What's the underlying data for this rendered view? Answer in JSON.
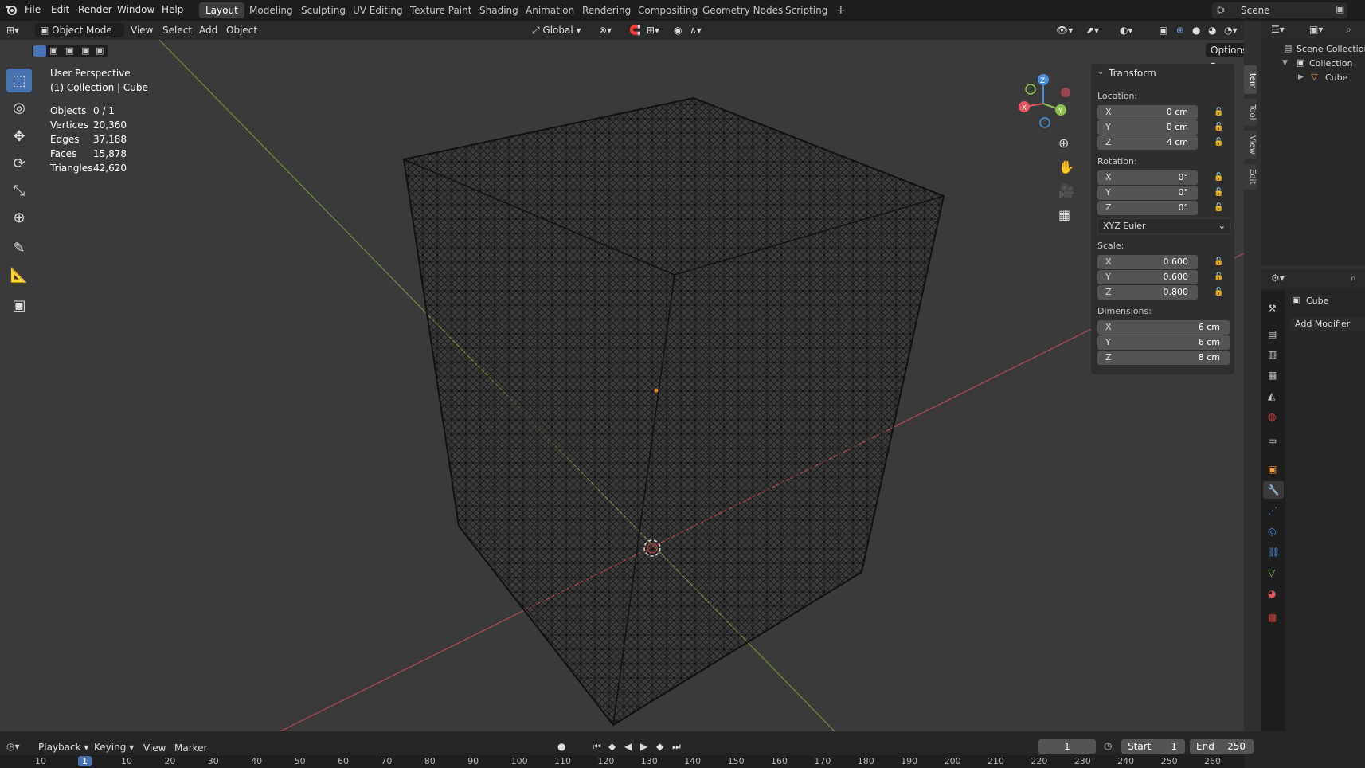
{
  "topbar": {
    "menus": [
      "File",
      "Edit",
      "Render",
      "Window",
      "Help"
    ],
    "workspaces": [
      "Layout",
      "Modeling",
      "Sculpting",
      "UV Editing",
      "Texture Paint",
      "Shading",
      "Animation",
      "Rendering",
      "Compositing",
      "Geometry Nodes",
      "Scripting"
    ],
    "add_tab": "+",
    "scene_label": "Scene"
  },
  "header": {
    "mode": "Object Mode",
    "menus": [
      "View",
      "Select",
      "Add",
      "Object"
    ],
    "orientation": "Global",
    "options_label": "Options"
  },
  "viewport": {
    "view_name": "User Perspective",
    "collection_line": "(1) Collection | Cube",
    "stats": [
      {
        "label": "Objects",
        "value": "0 / 1"
      },
      {
        "label": "Vertices",
        "value": "20,360"
      },
      {
        "label": "Edges",
        "value": "37,188"
      },
      {
        "label": "Faces",
        "value": "15,878"
      },
      {
        "label": "Triangles",
        "value": "42,620"
      }
    ],
    "gizmo": {
      "z": "Z",
      "y": "Y",
      "x": "X"
    }
  },
  "transform": {
    "title": "Transform",
    "location_label": "Location:",
    "location": [
      {
        "axis": "X",
        "value": "0 cm"
      },
      {
        "axis": "Y",
        "value": "0 cm"
      },
      {
        "axis": "Z",
        "value": "4 cm"
      }
    ],
    "rotation_label": "Rotation:",
    "rotation": [
      {
        "axis": "X",
        "value": "0°"
      },
      {
        "axis": "Y",
        "value": "0°"
      },
      {
        "axis": "Z",
        "value": "0°"
      }
    ],
    "rotation_mode": "XYZ Euler",
    "scale_label": "Scale:",
    "scale": [
      {
        "axis": "X",
        "value": "0.600"
      },
      {
        "axis": "Y",
        "value": "0.600"
      },
      {
        "axis": "Z",
        "value": "0.800"
      }
    ],
    "dimensions_label": "Dimensions:",
    "dimensions": [
      {
        "axis": "X",
        "value": "6 cm"
      },
      {
        "axis": "Y",
        "value": "6 cm"
      },
      {
        "axis": "Z",
        "value": "8 cm"
      }
    ]
  },
  "sidetabs": [
    "Item",
    "Tool",
    "View",
    "Edit"
  ],
  "outliner": {
    "scene_collection": "Scene Collection",
    "collection": "Collection",
    "object": "Cube"
  },
  "properties": {
    "object_name": "Cube",
    "add_modifier": "Add Modifier"
  },
  "timeline": {
    "menus": [
      "Playback",
      "Keying",
      "View",
      "Marker"
    ],
    "current_frame": "1",
    "start_label": "Start",
    "start_value": "1",
    "end_label": "End",
    "end_value": "250",
    "ruler": [
      "-10",
      "1",
      "10",
      "20",
      "30",
      "40",
      "50",
      "60",
      "70",
      "80",
      "90",
      "100",
      "110",
      "120",
      "130",
      "140",
      "150",
      "160",
      "170",
      "180",
      "190",
      "200",
      "210",
      "220",
      "230",
      "240",
      "250",
      "260"
    ]
  },
  "colors": {
    "accent": "#4772b3",
    "x_axis": "#e25561",
    "y_axis": "#8bc34a",
    "z_axis": "#4a90e2"
  }
}
